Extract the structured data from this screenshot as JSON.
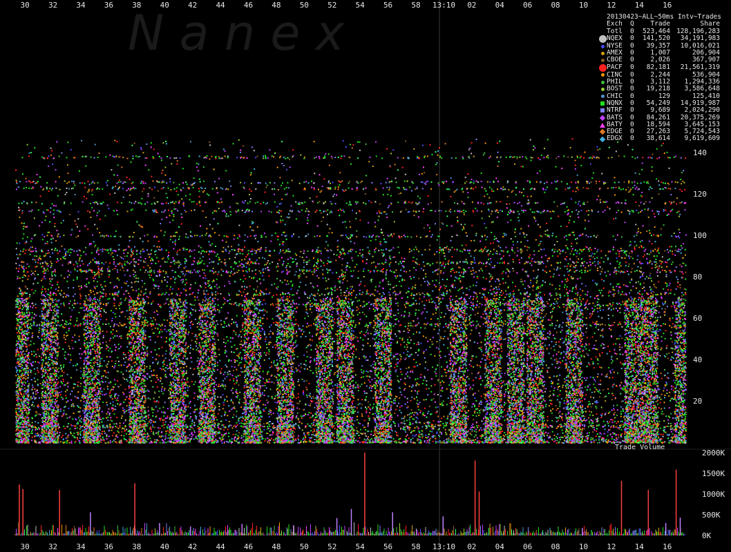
{
  "chart_data": [
    {
      "type": "scatter",
      "title": "20130423~ALL~50ms Intv~Trades",
      "watermark": "N a n e x",
      "x_tick_labels": [
        "30",
        "32",
        "34",
        "36",
        "38",
        "40",
        "42",
        "44",
        "46",
        "48",
        "50",
        "52",
        "54",
        "56",
        "58",
        "13:10",
        "02",
        "04",
        "06",
        "08",
        "10",
        "12",
        "14",
        "16"
      ],
      "y_tick_labels": [
        "20",
        "40",
        "60",
        "80",
        "100",
        "120",
        "140"
      ],
      "y_ticks": [
        20,
        40,
        60,
        80,
        100,
        120,
        140
      ],
      "ylim": [
        0,
        150
      ],
      "grid": false,
      "legend_position": "top-right",
      "legend": {
        "headers": {
          "exch": "Exch",
          "q": "Q",
          "trade": "Trade",
          "share": "Share"
        },
        "rows": [
          {
            "exch": "Totl",
            "q": "0",
            "trade": "523,464",
            "share": "128,196,283",
            "color": "#000000",
            "symbol": "none"
          },
          {
            "exch": "NQEX",
            "q": "0",
            "trade": "141,520",
            "share": "34,191,983",
            "color": "#c0c0c0",
            "symbol": "big-circle"
          },
          {
            "exch": "NYSE",
            "q": "0",
            "trade": "39,357",
            "share": "10,016,021",
            "color": "#4a4aff",
            "symbol": "dot"
          },
          {
            "exch": "AMEX",
            "q": "0",
            "trade": "1,007",
            "share": "206,904",
            "color": "#d4a017",
            "symbol": "dot"
          },
          {
            "exch": "CBOE",
            "q": "0",
            "trade": "2,026",
            "share": "367,907",
            "color": "#8a5a20",
            "symbol": "dot"
          },
          {
            "exch": "PACF",
            "q": "0",
            "trade": "82,181",
            "share": "21,561,319",
            "color": "#ff2020",
            "symbol": "big-circle"
          },
          {
            "exch": "CINC",
            "q": "0",
            "trade": "2,244",
            "share": "536,904",
            "color": "#ff9a00",
            "symbol": "dot"
          },
          {
            "exch": "PHIL",
            "q": "0",
            "trade": "3,112",
            "share": "1,294,336",
            "color": "#40c040",
            "symbol": "dot"
          },
          {
            "exch": "BOST",
            "q": "0",
            "trade": "19,218",
            "share": "3,586,648",
            "color": "#9acd32",
            "symbol": "dot"
          },
          {
            "exch": "CHIC",
            "q": "0",
            "trade": "129",
            "share": "125,410",
            "color": "#4f94cd",
            "symbol": "dot"
          },
          {
            "exch": "NQNX",
            "q": "0",
            "trade": "54,249",
            "share": "14,919,987",
            "color": "#20e020",
            "symbol": "square"
          },
          {
            "exch": "NTRF",
            "q": "0",
            "trade": "9,689",
            "share": "2,024,290",
            "color": "#8080ff",
            "symbol": "square"
          },
          {
            "exch": "BATS",
            "q": "0",
            "trade": "84,261",
            "share": "20,375,269",
            "color": "#c040ff",
            "symbol": "diamond"
          },
          {
            "exch": "BATY",
            "q": "0",
            "trade": "18,594",
            "share": "3,645,153",
            "color": "#ff40ff",
            "symbol": "triangle"
          },
          {
            "exch": "EDGE",
            "q": "0",
            "trade": "27,263",
            "share": "5,724,543",
            "color": "#e07820",
            "symbol": "diamond"
          },
          {
            "exch": "EDGX",
            "q": "0",
            "trade": "38,614",
            "share": "9,619,609",
            "color": "#40b0e0",
            "symbol": "diamond"
          }
        ]
      },
      "bursts": [
        0.35,
        2.45,
        5.45,
        8.7,
        11.6,
        13.7,
        16.95,
        19.3,
        22.1,
        23.6,
        26.3,
        31.7,
        34.2,
        35.8,
        37.2,
        40.0,
        44.2,
        45.4,
        47.8
      ],
      "scan_lines": [
        8,
        57,
        67,
        72,
        83,
        87,
        93,
        100,
        112,
        116,
        123,
        126,
        138
      ]
    },
    {
      "type": "bar",
      "title": "Trade Volume",
      "y_tick_labels": [
        "0K",
        "500K",
        "1000K",
        "1500K",
        "2000K"
      ],
      "y_ticks": [
        0,
        500,
        1000,
        1500,
        2000
      ],
      "ylim": [
        0,
        2000
      ],
      "spikes": [
        {
          "t": 0.4,
          "v": 1230
        },
        {
          "t": 0.75,
          "v": 1120
        },
        {
          "t": 4.3,
          "v": 1100
        },
        {
          "t": 7.3,
          "v": 560
        },
        {
          "t": 11.6,
          "v": 1260
        },
        {
          "t": 14.0,
          "v": 300
        },
        {
          "t": 17.0,
          "v": 220
        },
        {
          "t": 22.0,
          "v": 280
        },
        {
          "t": 27.0,
          "v": 250
        },
        {
          "t": 31.2,
          "v": 420
        },
        {
          "t": 32.6,
          "v": 640
        },
        {
          "t": 33.9,
          "v": 2000
        },
        {
          "t": 36.6,
          "v": 560
        },
        {
          "t": 41.5,
          "v": 460
        },
        {
          "t": 44.6,
          "v": 1810
        },
        {
          "t": 45.0,
          "v": 1060
        },
        {
          "t": 55.0,
          "v": 180
        },
        {
          "t": 58.8,
          "v": 1320
        },
        {
          "t": 61.4,
          "v": 1100
        },
        {
          "t": 63.1,
          "v": 300
        },
        {
          "t": 64.1,
          "v": 1590
        },
        {
          "t": 64.5,
          "v": 430
        }
      ]
    }
  ]
}
